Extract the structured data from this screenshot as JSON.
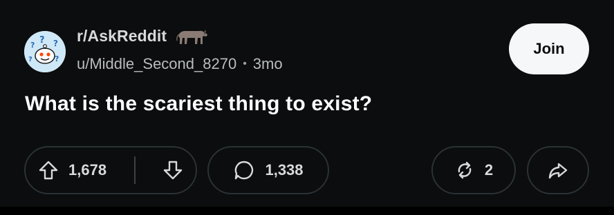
{
  "post": {
    "subreddit": "r/AskReddit",
    "author": "u/Middle_Second_8270",
    "separator": "•",
    "age": "3mo",
    "join_label": "Join",
    "title": "What is the scariest thing to exist?"
  },
  "actions": {
    "upvotes": "1,678",
    "comments": "1,338",
    "awards": "2"
  },
  "icons": {
    "avatar": "reddit-snoo-question-avatar",
    "badge": "horse-badge-icon",
    "upvote": "arrow-up-icon",
    "downvote": "arrow-down-icon",
    "comment": "comment-bubble-icon",
    "award": "crosspost-icon",
    "share": "share-arrow-icon"
  },
  "colors": {
    "background": "#0b0d0e",
    "text": "#ffffff",
    "muted": "#b8bdc0",
    "join_bg": "#f6f7f8",
    "pill_border": "#2a3236",
    "snoo_accent": "#4fbcff",
    "snoo_orange": "#ff4500"
  }
}
